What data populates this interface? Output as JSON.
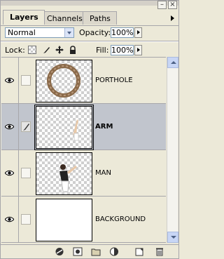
{
  "tabs": [
    {
      "label": "Layers",
      "active": true
    },
    {
      "label": "Channels",
      "active": false
    },
    {
      "label": "Paths",
      "active": false
    }
  ],
  "blend": {
    "mode": "Normal"
  },
  "opacity": {
    "label": "Opacity:",
    "value": "100%"
  },
  "lock": {
    "label": "Lock:"
  },
  "fill": {
    "label": "Fill:",
    "value": "100%"
  },
  "layers": [
    {
      "name": "PORTHOLE",
      "visible": true,
      "selected": false
    },
    {
      "name": "ARM",
      "visible": true,
      "selected": true
    },
    {
      "name": "MAN",
      "visible": true,
      "selected": false
    },
    {
      "name": "BACKGROUND",
      "visible": true,
      "selected": false
    }
  ],
  "window": {
    "close_glyph": "×",
    "minimize_glyph": "–"
  },
  "colors": {
    "selected_row": "#c1c5cd",
    "panel_bg": "#ece9d8"
  }
}
